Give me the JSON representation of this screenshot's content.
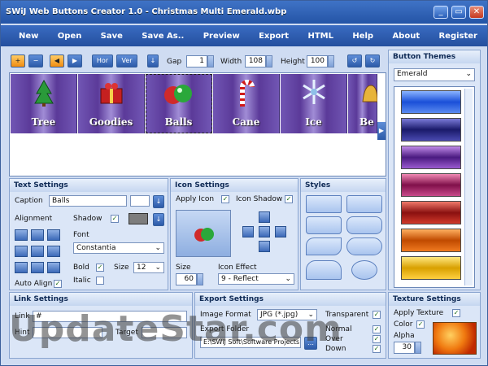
{
  "window": {
    "title": "SWiJ Web Buttons Creator 1.0 - Christmas Multi Emerald.wbp",
    "min": "_",
    "max": "▭",
    "close": "✕"
  },
  "menu": [
    "New",
    "Open",
    "Save",
    "Save As..",
    "Preview",
    "Export",
    "HTML",
    "Help",
    "About",
    "Register"
  ],
  "toolbar": {
    "hor": "Hor",
    "ver": "Ver",
    "gap_label": "Gap",
    "gap": "1",
    "width_label": "Width",
    "width": "108",
    "height_label": "Height",
    "height": "100"
  },
  "buttons": [
    {
      "label": "Tree",
      "icon": "tree-icon"
    },
    {
      "label": "Goodies",
      "icon": "gifts-icon"
    },
    {
      "label": "Balls",
      "icon": "ornament-balls-icon",
      "selected": true
    },
    {
      "label": "Cane",
      "icon": "candy-cane-icon"
    },
    {
      "label": "Ice",
      "icon": "snowflake-icon"
    },
    {
      "label": "Be",
      "icon": "bells-icon"
    }
  ],
  "text_settings": {
    "title": "Text Settings",
    "caption_label": "Caption",
    "caption": "Balls",
    "alignment_label": "Alignment",
    "shadow_label": "Shadow",
    "font_label": "Font",
    "font": "Constantia",
    "bold_label": "Bold",
    "size_label": "Size",
    "size": "12",
    "italic_label": "Italic",
    "auto_align_label": "Auto Align"
  },
  "icon_settings": {
    "title": "Icon Settings",
    "apply_icon_label": "Apply Icon",
    "icon_shadow_label": "Icon Shadow",
    "size_label": "Size",
    "size": "60",
    "effect_label": "Icon Effect",
    "effect": "9 - Reflect"
  },
  "styles": {
    "title": "Styles"
  },
  "button_themes": {
    "title": "Button Themes",
    "selected": "Emerald"
  },
  "link_settings": {
    "title": "Link Settings",
    "link_label": "Link",
    "link": "#",
    "hint_label": "Hint",
    "target_label": "Target"
  },
  "export_settings": {
    "title": "Export Settings",
    "format_label": "Image Format",
    "format": "JPG (*.jpg)",
    "folder_label": "Export Folder",
    "folder": "E:\\SWiJ Soft\\Software Projects",
    "transparent_label": "Transparent",
    "normal_label": "Normal",
    "over_label": "Over",
    "down_label": "Down"
  },
  "texture_settings": {
    "title": "Texture Settings",
    "apply_label": "Apply Texture",
    "color_label": "Color",
    "alpha_label": "Alpha",
    "alpha": "30"
  },
  "watermark": "UpdateStar.com",
  "colors": {
    "accent": "#2a5aa8",
    "check": "#1a6b1a"
  }
}
